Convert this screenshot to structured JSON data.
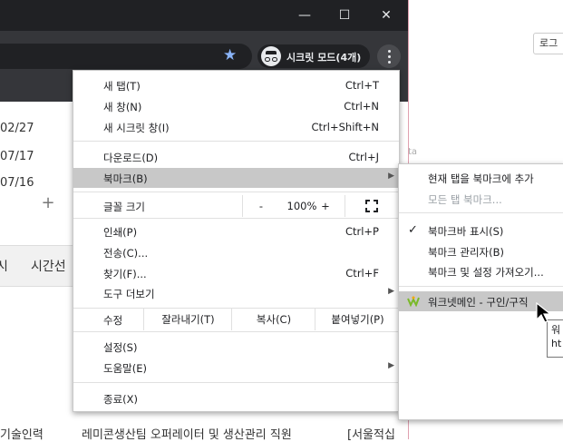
{
  "window": {
    "minimize_glyph": "—",
    "maximize_glyph": "☐",
    "close_glyph": "✕"
  },
  "toolbar": {
    "star_glyph": "★",
    "incognito_label": "시크릿 모드(4개)"
  },
  "background_page": {
    "login_label": "로그",
    "faint_text": "ta",
    "dates": [
      "02/27",
      "07/17",
      "07/16"
    ],
    "tab_texts": [
      "시",
      "시간선"
    ],
    "bottom_texts": [
      "기술인력",
      "레미콘생산팀 오퍼레이터 및 생산관리 직원",
      "[서울적십"
    ]
  },
  "menu": {
    "items": [
      {
        "label": "새 탭(T)",
        "shortcut": "Ctrl+T"
      },
      {
        "label": "새 창(N)",
        "shortcut": "Ctrl+N"
      },
      {
        "label": "새 시크릿 창(I)",
        "shortcut": "Ctrl+Shift+N"
      },
      {
        "label": "다운로드(D)",
        "shortcut": "Ctrl+J"
      },
      {
        "label": "북마크(B)",
        "shortcut": ""
      },
      {
        "label": "인쇄(P)",
        "shortcut": "Ctrl+P"
      },
      {
        "label": "전송(C)...",
        "shortcut": ""
      },
      {
        "label": "찾기(F)...",
        "shortcut": "Ctrl+F"
      },
      {
        "label": "도구 더보기",
        "shortcut": ""
      },
      {
        "label": "설정(S)",
        "shortcut": ""
      },
      {
        "label": "도움말(E)",
        "shortcut": ""
      },
      {
        "label": "종료(X)",
        "shortcut": ""
      }
    ],
    "zoom": {
      "label": "글꼴 크기",
      "minus": "-",
      "value": "100%",
      "plus": "+"
    },
    "edit": {
      "label": "수정",
      "cut": "잘라내기(T)",
      "copy": "복사(C)",
      "paste": "붙여넣기(P)"
    }
  },
  "bookmarks_submenu": {
    "items": [
      {
        "label": "현재 탭을 북마크에 추가"
      },
      {
        "label": "모든 탭 북마크..."
      },
      {
        "label": "북마크바 표시(S)",
        "checked": true
      },
      {
        "label": "북마크 관리자(B)"
      },
      {
        "label": "북마크 및 설정 가져오기..."
      },
      {
        "label": "워크넷메인 - 구인/구직"
      }
    ],
    "check_glyph": "✓"
  },
  "tooltip": {
    "line1": "워",
    "line2": "ht"
  },
  "colors": {
    "titlebar": "#202124",
    "toolbar": "#35363a",
    "highlight": "#c8c8c8",
    "star": "#8ab4f8",
    "worknet_green": "#7ab929"
  }
}
